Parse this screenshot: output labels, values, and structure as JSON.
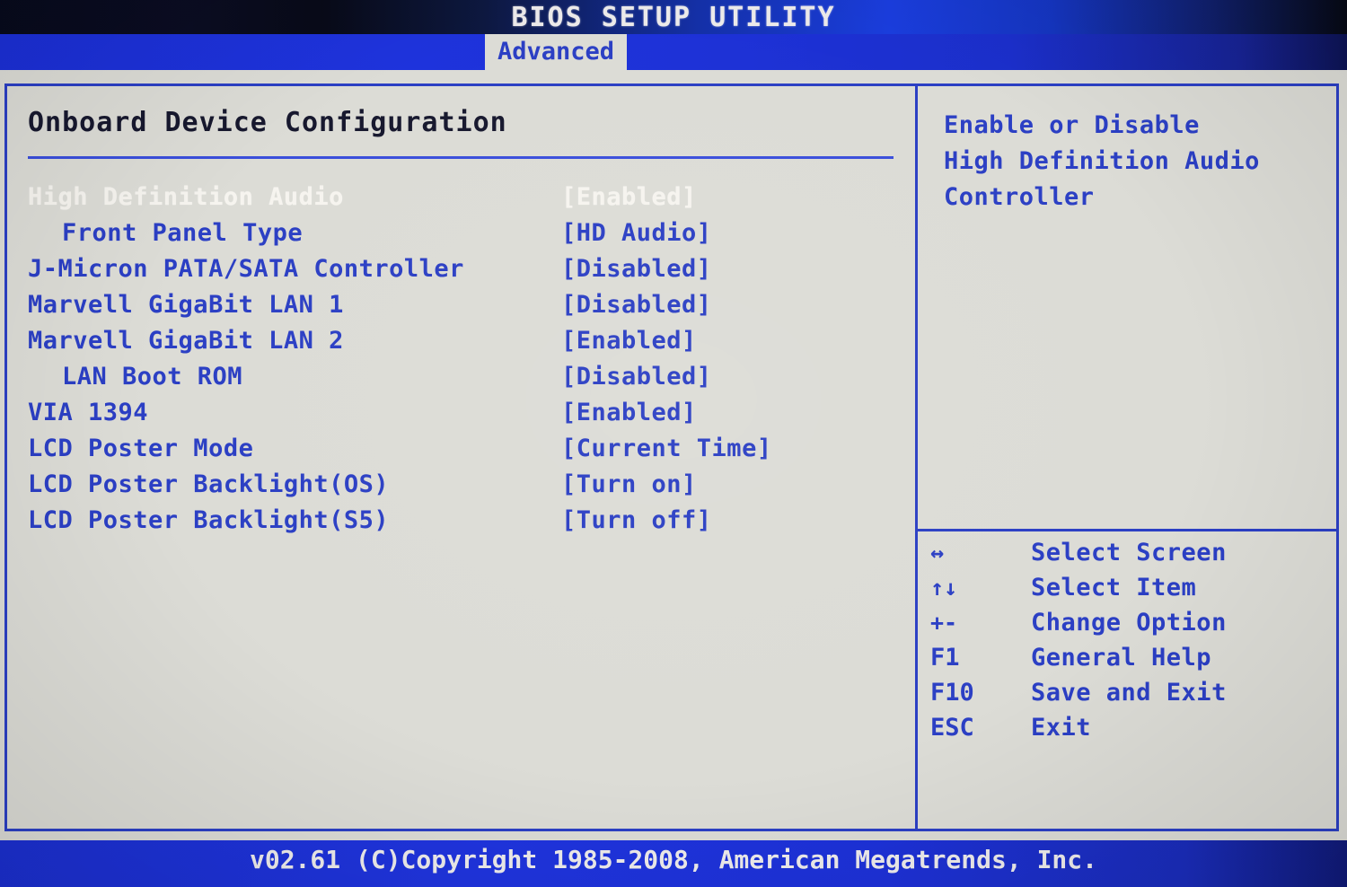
{
  "header": {
    "title": "BIOS SETUP UTILITY",
    "active_tab": "Advanced"
  },
  "main": {
    "section_title": "Onboard Device Configuration",
    "rows": [
      {
        "label": "High Definition Audio",
        "value": "[Enabled]",
        "indent": false,
        "selected": true
      },
      {
        "label": "Front Panel Type",
        "value": "[HD Audio]",
        "indent": true,
        "selected": false
      },
      {
        "label": "J-Micron PATA/SATA Controller",
        "value": "[Disabled]",
        "indent": false,
        "selected": false
      },
      {
        "label": "Marvell GigaBit LAN 1",
        "value": "[Disabled]",
        "indent": false,
        "selected": false
      },
      {
        "label": "Marvell GigaBit LAN 2",
        "value": "[Enabled]",
        "indent": false,
        "selected": false
      },
      {
        "label": "LAN Boot ROM",
        "value": "[Disabled]",
        "indent": true,
        "selected": false
      },
      {
        "label": "VIA 1394",
        "value": "[Enabled]",
        "indent": false,
        "selected": false
      },
      {
        "label": "LCD Poster Mode",
        "value": "[Current Time]",
        "indent": false,
        "selected": false
      },
      {
        "label": "LCD Poster Backlight(OS)",
        "value": "[Turn on]",
        "indent": false,
        "selected": false
      },
      {
        "label": "LCD Poster Backlight(S5)",
        "value": "[Turn off]",
        "indent": false,
        "selected": false
      }
    ]
  },
  "help": {
    "lines": [
      "Enable or Disable",
      "High Definition Audio",
      "Controller"
    ]
  },
  "keys": [
    {
      "icon": "left-right-arrow-icon",
      "key": "↔",
      "desc": "Select Screen"
    },
    {
      "icon": "up-down-arrow-icon",
      "key": "↑↓",
      "desc": "Select Item"
    },
    {
      "icon": "plus-minus-icon",
      "key": "+-",
      "desc": "Change Option"
    },
    {
      "icon": "f1-key-icon",
      "key": "F1",
      "desc": "General Help"
    },
    {
      "icon": "f10-key-icon",
      "key": "F10",
      "desc": "Save and Exit"
    },
    {
      "icon": "esc-key-icon",
      "key": "ESC",
      "desc": "Exit"
    }
  ],
  "footer": {
    "copyright": "v02.61 (C)Copyright 1985-2008, American Megatrends, Inc."
  },
  "colors": {
    "accent_blue": "#2b3fc4",
    "header_blue": "#1d31d8",
    "panel_bg": "#dcdcd6",
    "selected_text": "#f6f4ef",
    "section_title": "#17182e"
  }
}
